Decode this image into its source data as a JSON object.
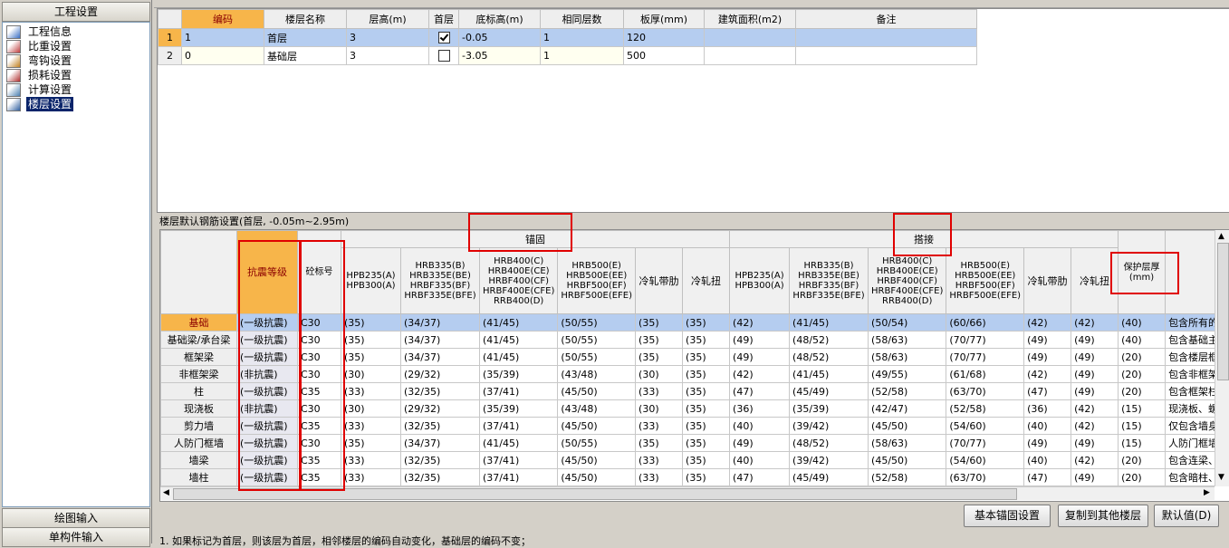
{
  "left_panel": {
    "title": "工程设置",
    "tree_items": [
      {
        "label": "工程信息",
        "icon": "document-info-icon"
      },
      {
        "label": "比重设置",
        "icon": "weight-icon"
      },
      {
        "label": "弯钩设置",
        "icon": "hook-icon"
      },
      {
        "label": "损耗设置",
        "icon": "loss-icon"
      },
      {
        "label": "计算设置",
        "icon": "calculate-icon"
      },
      {
        "label": "楼层设置",
        "icon": "floor-icon"
      }
    ],
    "bottom_buttons": [
      "绘图输入",
      "单构件输入"
    ]
  },
  "floor_table": {
    "headers": [
      "编码",
      "楼层名称",
      "层高(m)",
      "首层",
      "底标高(m)",
      "相同层数",
      "板厚(mm)",
      "建筑面积(m2)",
      "备注"
    ],
    "rows": [
      {
        "num": "1",
        "code": "1",
        "name": "首层",
        "height": "3",
        "first": true,
        "bottom": "-0.05",
        "same": "1",
        "thick": "120",
        "area": "",
        "note": ""
      },
      {
        "num": "2",
        "code": "0",
        "name": "基础层",
        "height": "3",
        "first": false,
        "bottom": "-3.05",
        "same": "1",
        "thick": "500",
        "area": "",
        "note": ""
      }
    ]
  },
  "rebar_section": {
    "title": "楼层默认钢筋设置(首层, -0.05m~2.95m)",
    "group_anchor": "锚固",
    "group_splice": "搭接",
    "col_seismic": "抗震等级",
    "col_concrete": "砼标号",
    "steel_headers": [
      "HPB235(A)\nHPB300(A)",
      "HRB335(B)\nHRB335E(BE)\nHRBF335(BF)\nHRBF335E(BFE)",
      "HRB400(C)\nHRB400E(CE)\nHRBF400(CF)\nHRBF400E(CFE)\nRRB400(D)",
      "HRB500(E)\nHRB500E(EE)\nHRBF500(EF)\nHRBF500E(EFE)",
      "冷轧带肋",
      "冷轧扭"
    ],
    "cover_header": "保护层厚\n(mm)",
    "rows": [
      {
        "name": "基础",
        "seismic": "(一级抗震)",
        "concrete": "C30",
        "anchor": [
          "(35)",
          "(34/37)",
          "(41/45)",
          "(50/55)",
          "(35)",
          "(35)"
        ],
        "splice": [
          "(42)",
          "(41/45)",
          "(50/54)",
          "(60/66)",
          "(42)",
          "(42)"
        ],
        "cover": "(40)",
        "note": "包含所有的"
      },
      {
        "name": "基础梁/承台梁",
        "seismic": "(一级抗震)",
        "concrete": "C30",
        "anchor": [
          "(35)",
          "(34/37)",
          "(41/45)",
          "(50/55)",
          "(35)",
          "(35)"
        ],
        "splice": [
          "(49)",
          "(48/52)",
          "(58/63)",
          "(70/77)",
          "(49)",
          "(49)"
        ],
        "cover": "(40)",
        "note": "包含基础主"
      },
      {
        "name": "框架梁",
        "seismic": "(一级抗震)",
        "concrete": "C30",
        "anchor": [
          "(35)",
          "(34/37)",
          "(41/45)",
          "(50/55)",
          "(35)",
          "(35)"
        ],
        "splice": [
          "(49)",
          "(48/52)",
          "(58/63)",
          "(70/77)",
          "(49)",
          "(49)"
        ],
        "cover": "(20)",
        "note": "包含楼层框"
      },
      {
        "name": "非框架梁",
        "seismic": "(非抗震)",
        "concrete": "C30",
        "anchor": [
          "(30)",
          "(29/32)",
          "(35/39)",
          "(43/48)",
          "(30)",
          "(35)"
        ],
        "splice": [
          "(42)",
          "(41/45)",
          "(49/55)",
          "(61/68)",
          "(42)",
          "(49)"
        ],
        "cover": "(20)",
        "note": "包含非框架"
      },
      {
        "name": "柱",
        "seismic": "(一级抗震)",
        "concrete": "C35",
        "anchor": [
          "(33)",
          "(32/35)",
          "(37/41)",
          "(45/50)",
          "(33)",
          "(35)"
        ],
        "splice": [
          "(47)",
          "(45/49)",
          "(52/58)",
          "(63/70)",
          "(47)",
          "(49)"
        ],
        "cover": "(20)",
        "note": "包含框架柱"
      },
      {
        "name": "现浇板",
        "seismic": "(非抗震)",
        "concrete": "C30",
        "anchor": [
          "(30)",
          "(29/32)",
          "(35/39)",
          "(43/48)",
          "(30)",
          "(35)"
        ],
        "splice": [
          "(36)",
          "(35/39)",
          "(42/47)",
          "(52/58)",
          "(36)",
          "(42)"
        ],
        "cover": "(15)",
        "note": "现浇板、螺"
      },
      {
        "name": "剪力墙",
        "seismic": "(一级抗震)",
        "concrete": "C35",
        "anchor": [
          "(33)",
          "(32/35)",
          "(37/41)",
          "(45/50)",
          "(33)",
          "(35)"
        ],
        "splice": [
          "(40)",
          "(39/42)",
          "(45/50)",
          "(54/60)",
          "(40)",
          "(42)"
        ],
        "cover": "(15)",
        "note": "仅包含墙身"
      },
      {
        "name": "人防门框墙",
        "seismic": "(一级抗震)",
        "concrete": "C30",
        "anchor": [
          "(35)",
          "(34/37)",
          "(41/45)",
          "(50/55)",
          "(35)",
          "(35)"
        ],
        "splice": [
          "(49)",
          "(48/52)",
          "(58/63)",
          "(70/77)",
          "(49)",
          "(49)"
        ],
        "cover": "(15)",
        "note": "人防门框墙"
      },
      {
        "name": "墙梁",
        "seismic": "(一级抗震)",
        "concrete": "C35",
        "anchor": [
          "(33)",
          "(32/35)",
          "(37/41)",
          "(45/50)",
          "(33)",
          "(35)"
        ],
        "splice": [
          "(40)",
          "(39/42)",
          "(45/50)",
          "(54/60)",
          "(40)",
          "(42)"
        ],
        "cover": "(20)",
        "note": "包含连梁、"
      },
      {
        "name": "墙柱",
        "seismic": "(一级抗震)",
        "concrete": "C35",
        "anchor": [
          "(33)",
          "(32/35)",
          "(37/41)",
          "(45/50)",
          "(33)",
          "(35)"
        ],
        "splice": [
          "(47)",
          "(45/49)",
          "(52/58)",
          "(63/70)",
          "(47)",
          "(49)"
        ],
        "cover": "(20)",
        "note": "包含暗柱、"
      }
    ]
  },
  "buttons": {
    "basic_anchor": "基本锚固设置",
    "copy_floors": "复制到其他楼层",
    "default": "默认值(D)"
  },
  "note_text": "1. 如果标记为首层，则该层为首层，相邻楼层的编码自动变化，基础层的编码不变；",
  "colors": {
    "selected_row": "#b5cdf0",
    "highlight": "#f7b54a",
    "red_box": "#e00000"
  }
}
